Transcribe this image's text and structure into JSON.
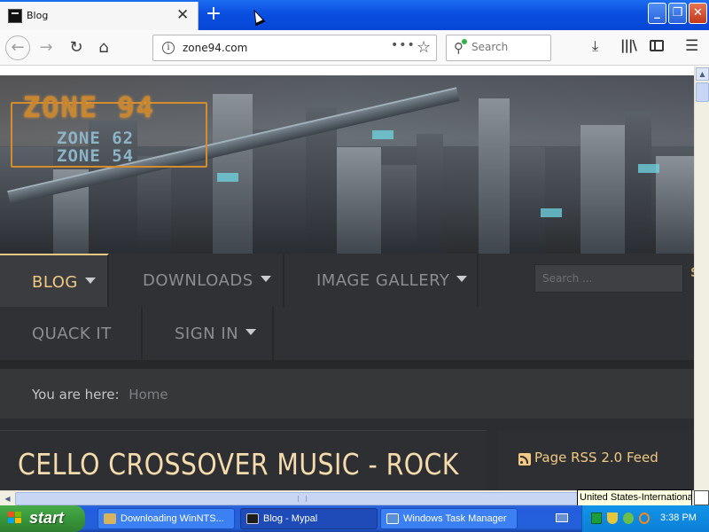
{
  "browser": {
    "tab_title": "Blog",
    "tab_close": "✕",
    "new_tab": "+",
    "window_controls": {
      "minimize": "_",
      "maximize": "❐",
      "close": "✕"
    },
    "url": "zone94.com",
    "search_placeholder": "Search",
    "icons": [
      "back-arrow-icon",
      "forward-arrow-icon",
      "reload-icon",
      "home-icon",
      "info-icon",
      "page-actions-icon",
      "bookmark-star-icon",
      "search-icon",
      "download-icon",
      "library-icon",
      "sidebar-icon",
      "hamburger-menu-icon"
    ]
  },
  "site": {
    "logo_main": "ZONE 94",
    "logo_sub1": "ZONE 62",
    "logo_sub2": "ZONE 54",
    "nav": {
      "row1": [
        {
          "label": "BLOG",
          "active": true,
          "has_dropdown": true
        },
        {
          "label": "DOWNLOADS",
          "active": false,
          "has_dropdown": true
        },
        {
          "label": "IMAGE GALLERY",
          "active": false,
          "has_dropdown": true
        }
      ],
      "row2": [
        {
          "label": "QUACK IT",
          "active": false,
          "has_dropdown": false
        },
        {
          "label": "SIGN IN",
          "active": false,
          "has_dropdown": true
        }
      ]
    },
    "search_placeholder": "Search ...",
    "search_button_partial": "S",
    "breadcrumb": {
      "label": "You are here:",
      "home": "Home"
    },
    "article_title": "CELLO CROSSOVER MUSIC - ROCK",
    "rss_label": "Page RSS 2.0 Feed",
    "colors": {
      "accent": "#f1c983",
      "nav_bg": "#2f3134",
      "title": "#f6dcad"
    }
  },
  "os": {
    "keyboard_tooltip": "United States-International",
    "start_label": "start",
    "tasks": [
      {
        "label": "Downloading WinNTS...",
        "active": false
      },
      {
        "label": "Blog - Mypal",
        "active": true
      },
      {
        "label": "Windows Task Manager",
        "active": false
      }
    ],
    "clock": "3:38 PM"
  }
}
